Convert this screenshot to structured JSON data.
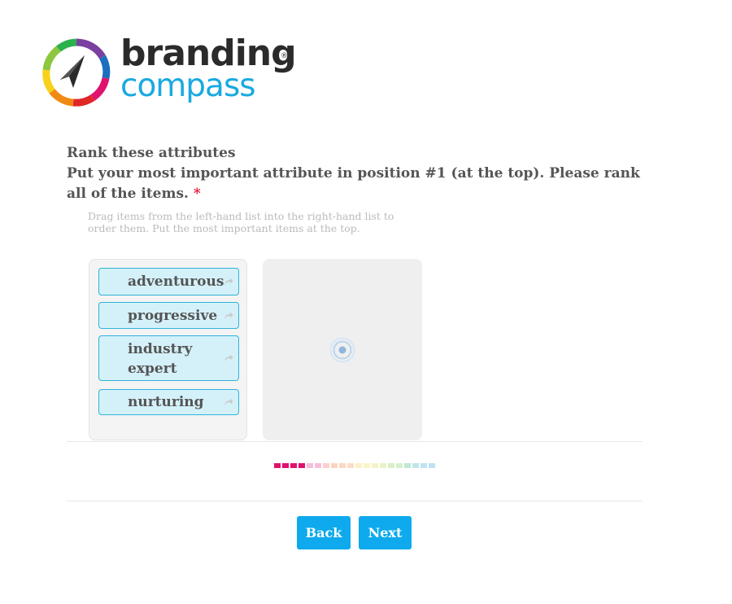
{
  "brand": {
    "line1": "branding",
    "line2": "compass",
    "registered": "®"
  },
  "question": {
    "title": "Rank these attributes",
    "subtitle": "Put your most important attribute in position #1 (at the top). Please rank all of the items.",
    "required_mark": "*",
    "help_text": "Drag items from the left-hand list into the right-hand list to order them. Put the most important items at the top."
  },
  "ranking": {
    "available_items": [
      {
        "label": "adventurous"
      },
      {
        "label": "progressive"
      },
      {
        "label": "industry expert"
      },
      {
        "label": "nurturing"
      }
    ],
    "ranked_items": []
  },
  "progress": {
    "colors": [
      "#e0126f",
      "#e0126f",
      "#e0126f",
      "#e0126f",
      "#f5bedb",
      "#f5bedb",
      "#fbd1cf",
      "#fbd5c0",
      "#fad9c4",
      "#fbdcc6",
      "#fbf1c6",
      "#fbf4c6",
      "#f1f5c6",
      "#e8f3c6",
      "#d9efc9",
      "#d6efce",
      "#bfe8d2",
      "#bfe7e8",
      "#bfe4f3",
      "#bde2f5"
    ]
  },
  "buttons": {
    "back": "Back",
    "next": "Next"
  },
  "colors": {
    "accent": "#0eaaed",
    "item_bg": "#d4f1fa",
    "item_border": "#2fb3d9",
    "required": "#e11a3c"
  },
  "icons": {
    "item_arrow": "share-arrow-icon",
    "loading": "loading-spinner-icon",
    "logo": "compass-logo-icon"
  }
}
